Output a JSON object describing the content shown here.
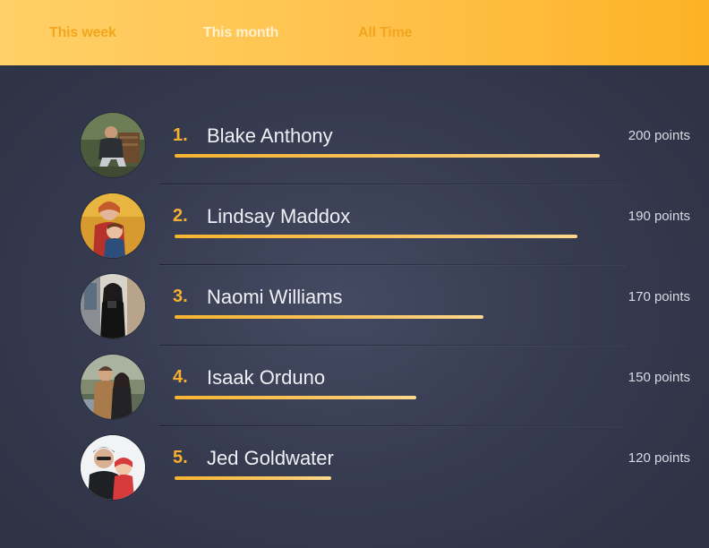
{
  "tabs": [
    {
      "label": "This week",
      "active": false
    },
    {
      "label": "This month",
      "active": true
    },
    {
      "label": "All Time",
      "active": false
    }
  ],
  "colors": {
    "accent": "#f7b02e",
    "header_start": "#ffd067",
    "header_end": "#fcb225",
    "background": "#363b50",
    "name_text": "#eef0f5"
  },
  "leaderboard": [
    {
      "rank": "1.",
      "name": "Blake Anthony",
      "points": "200 points",
      "points_value": 200,
      "progress": 0.95
    },
    {
      "rank": "2.",
      "name": "Lindsay Maddox",
      "points": "190 points",
      "points_value": 190,
      "progress": 0.9
    },
    {
      "rank": "3.",
      "name": "Naomi Williams",
      "points": "170 points",
      "points_value": 170,
      "progress": 0.69
    },
    {
      "rank": "4.",
      "name": "Isaak Orduno",
      "points": "150 points",
      "points_value": 150,
      "progress": 0.54
    },
    {
      "rank": "5.",
      "name": "Jed Goldwater",
      "points": "120 points",
      "points_value": 120,
      "progress": 0.35
    }
  ]
}
